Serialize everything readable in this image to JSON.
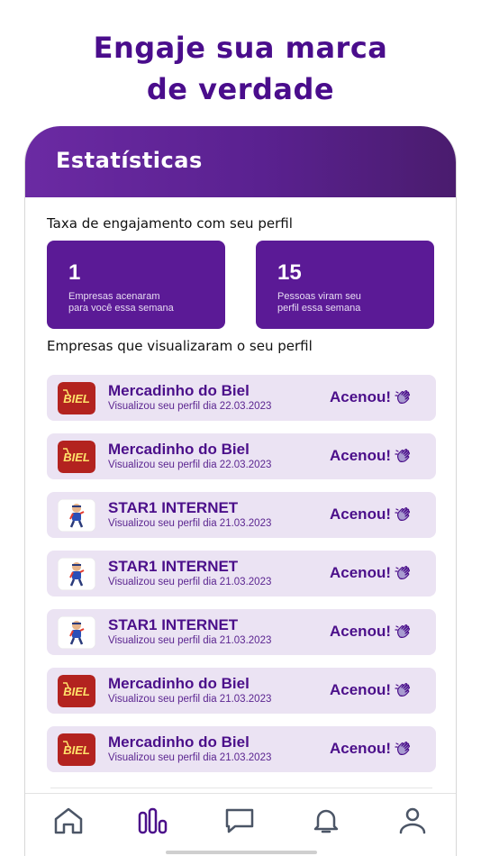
{
  "headline": {
    "line1": "Engaje sua marca",
    "line2": "de verdade"
  },
  "header": {
    "title": "Estatísticas"
  },
  "engagement": {
    "title": "Taxa de engajamento com seu perfil",
    "cards": [
      {
        "value": "1",
        "line1": "Empresas acenaram",
        "line2": "para você essa semana"
      },
      {
        "value": "15",
        "line1": "Pessoas viram seu",
        "line2": "perfil essa semana"
      }
    ]
  },
  "visitors": {
    "title": "Empresas que visualizaram o seu perfil",
    "wave_label": "Acenou!",
    "items": [
      {
        "name": "Mercadinho do Biel",
        "date": "Visualizou seu perfil dia 22.03.2023",
        "logo": "biel-logo"
      },
      {
        "name": "Mercadinho do Biel",
        "date": "Visualizou seu perfil dia 22.03.2023",
        "logo": "biel-logo"
      },
      {
        "name": "STAR1 INTERNET",
        "date": "Visualizou seu perfil dia 21.03.2023",
        "logo": "star1-logo"
      },
      {
        "name": "STAR1 INTERNET",
        "date": "Visualizou seu perfil dia 21.03.2023",
        "logo": "star1-logo"
      },
      {
        "name": "STAR1 INTERNET",
        "date": "Visualizou seu perfil dia 21.03.2023",
        "logo": "star1-logo"
      },
      {
        "name": "Mercadinho do Biel",
        "date": "Visualizou seu perfil dia 21.03.2023",
        "logo": "biel-logo"
      },
      {
        "name": "Mercadinho do Biel",
        "date": "Visualizou seu perfil dia 21.03.2023",
        "logo": "biel-logo"
      }
    ]
  },
  "tabbar": {
    "items": [
      {
        "icon": "home-icon"
      },
      {
        "icon": "stats-icon",
        "active": true
      },
      {
        "icon": "chat-icon"
      },
      {
        "icon": "bell-icon"
      },
      {
        "icon": "profile-icon"
      }
    ]
  },
  "colors": {
    "brand": "#5b1a96",
    "text_brand": "#4b0f8a",
    "row_bg": "#ebe3f3"
  }
}
